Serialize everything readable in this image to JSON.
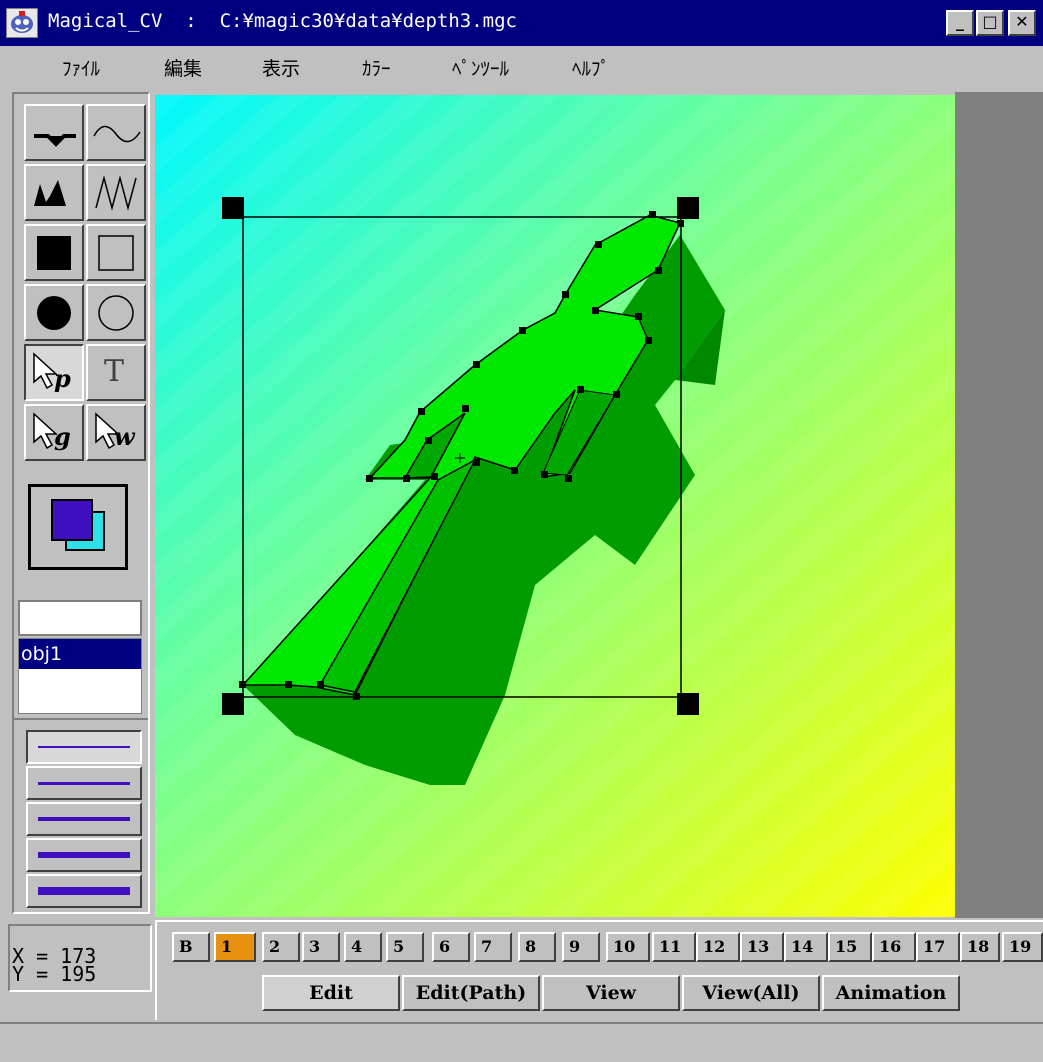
{
  "window": {
    "title": "Magical_CV  :  C:¥magic30¥data¥depth3.mgc",
    "minimize_label": "_",
    "maximize_label": "□",
    "close_label": "✕"
  },
  "menu": [
    "ﾌｧｲﾙ",
    "編集",
    "表示",
    "ｶﾗｰ",
    "ﾍﾟﾝﾂｰﾙ",
    "ﾍﾙﾌﾟ"
  ],
  "tools": {
    "text_tool_label": "T",
    "pen_select_letter": "p",
    "group_select_letter": "g",
    "whole_select_letter": "w"
  },
  "colors": {
    "fill": "#4010c0",
    "stroke": "#30e0e8",
    "object_green": "#00e000"
  },
  "layers": {
    "name_input_value": "",
    "items": [
      "obj1"
    ]
  },
  "line_widths": [
    2,
    3,
    4,
    6,
    8
  ],
  "status": {
    "x": "X = 173",
    "y": "Y = 195"
  },
  "frames": [
    "B",
    "1",
    "2",
    "3",
    "4",
    "5",
    "6",
    "7",
    "8",
    "9",
    "10",
    "11",
    "12",
    "13",
    "14",
    "15",
    "16",
    "17",
    "18",
    "19"
  ],
  "active_frame": "1",
  "modes": [
    "Edit",
    "Edit(Path)",
    "View",
    "View(All)",
    "Animation"
  ],
  "active_mode": "Edit"
}
